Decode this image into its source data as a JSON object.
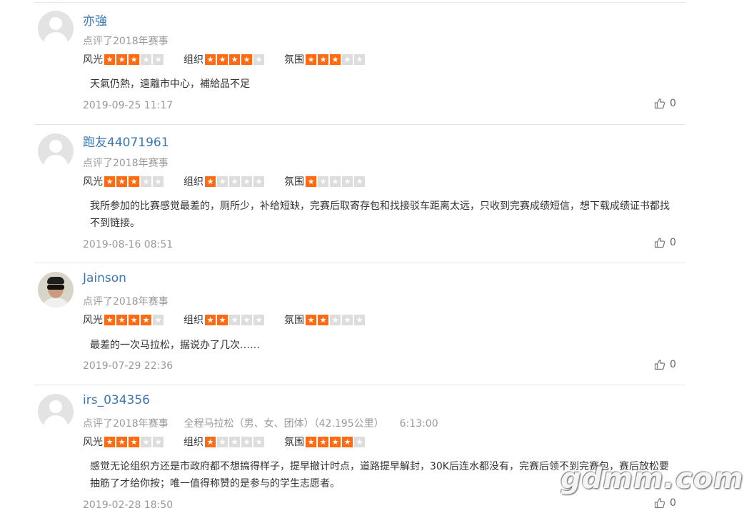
{
  "rating_labels": [
    "风光",
    "组织",
    "氛围"
  ],
  "reviews": [
    {
      "username": "亦強",
      "action": "点评了2018年赛事",
      "race": "",
      "time": "",
      "ratings": [
        3,
        4,
        3
      ],
      "content": "天氣仍熱，遠離市中心，補給品不足",
      "date": "2019-09-25 11:17",
      "likes": "0"
    },
    {
      "username": "跑友44071961",
      "action": "点评了2018年赛事",
      "race": "",
      "time": "",
      "ratings": [
        3,
        1,
        1
      ],
      "content": "我所参加的比赛感觉最差的，厕所少，补给短缺，完赛后取寄存包和找接驳车距离太远，只收到完赛成绩短信，想下载成绩证书都找不到链接。",
      "date": "2019-08-16 08:51",
      "likes": "0"
    },
    {
      "username": "Jainson",
      "action": "点评了2018年赛事",
      "race": "",
      "time": "",
      "ratings": [
        4,
        2,
        2
      ],
      "content": "最差的一次马拉松，据说办了几次……",
      "date": "2019-07-29 22:36",
      "likes": "0"
    },
    {
      "username": "irs_034356",
      "action": "点评了2018年赛事",
      "race": "全程马拉松（男、女、团体）（42.195公里）",
      "time": "6:13:00",
      "ratings": [
        3,
        1,
        4
      ],
      "content": "感觉无论组织方还是市政府都不想搞得样子，提早撤计时点，道路提早解封，30K后连水都没有，完赛后领不到完赛包，赛后放松要抽筋了才给你按；唯一值得称赞的是参与的学生志愿者。",
      "date": "2019-02-28 18:50",
      "likes": "0"
    }
  ],
  "watermark": "gdmm.com",
  "colors": {
    "star_on": "#ff6a13",
    "star_off": "#dddddd",
    "username": "#3d78b0",
    "meta": "#999999"
  },
  "icons": {
    "avatar": "default-avatar-icon",
    "star": "star-icon",
    "like": "thumbs-up-icon"
  }
}
